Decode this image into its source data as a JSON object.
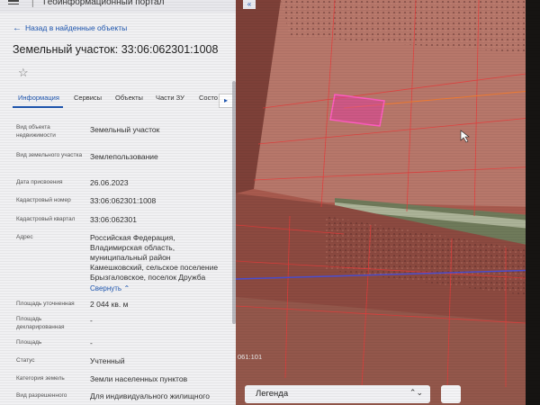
{
  "app": {
    "title": "Геоинформационный портал"
  },
  "back_link": "Назад в найденные объекты",
  "heading": "Земельный участок: 33:06:062301:1008",
  "tabs": [
    "Информация",
    "Сервисы",
    "Объекты",
    "Части ЗУ",
    "Состо"
  ],
  "details": [
    {
      "label": "Вид объекта недвижимости",
      "value": "Земельный участок"
    },
    {
      "label": "Вид земельного участка",
      "value": "Землепользование"
    },
    {
      "label": "Дата присвоения",
      "value": "26.06.2023"
    },
    {
      "label": "Кадастровый номер",
      "value": "33:06:062301:1008"
    },
    {
      "label": "Кадастровый квартал",
      "value": "33:06:062301"
    },
    {
      "label": "Адрес",
      "value_lines": [
        "Российская Федерация,",
        "Владимирская область,",
        "муниципальный район",
        "Камешковский, сельское поселение",
        "Брызгаловское, поселок Дружба"
      ],
      "link": "Свернуть"
    },
    {
      "label": "Площадь уточненная",
      "value": "2 044 кв. м"
    },
    {
      "label": "Площадь декларированная",
      "value": "-"
    },
    {
      "label": "Площадь",
      "value": "-"
    },
    {
      "label": "Статус",
      "value": "Учтенный"
    },
    {
      "label": "Категория земель",
      "value": "Земли населенных пунктов"
    },
    {
      "label": "Вид разрешенного",
      "value": "Для индивидуального жилищного"
    }
  ],
  "map": {
    "coord_label": "061:101",
    "legend": "Легенда"
  },
  "colors": {
    "accent": "#1e56b0",
    "parcel": "#e0409a",
    "map_tint": "#a85a4e"
  },
  "icons": {
    "menu": "menu-icon",
    "star": "star-icon",
    "back": "arrow-left-icon",
    "chevron": "chevron-updown-icon",
    "tab_next": "chevron-right-icon"
  }
}
